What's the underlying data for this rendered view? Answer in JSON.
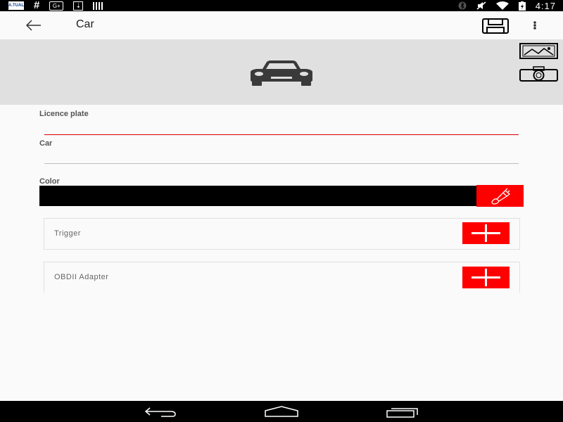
{
  "status_bar": {
    "left_icons": [
      "carrier-logo-icon",
      "hash-icon",
      "google-plus-icon",
      "download-icon",
      "barcode-icon"
    ],
    "carrier_text": "A.TUAL",
    "right_icons": [
      "bluetooth-icon",
      "mute-icon",
      "wifi-icon",
      "battery-icon"
    ],
    "time": "4:17"
  },
  "app_bar": {
    "title": "Car",
    "back_icon": "arrow-back-icon",
    "save_icon": "floppy-disk-icon",
    "overflow_icon": "more-vert-icon"
  },
  "header": {
    "image_icon": "car-icon",
    "gallery_icon": "image-icon",
    "camera_icon": "camera-icon"
  },
  "form": {
    "licence_plate": {
      "label": "Licence plate",
      "value": ""
    },
    "car": {
      "label": "Car",
      "value": ""
    },
    "color": {
      "label": "Color",
      "value": "#000000",
      "picker_icon": "paintbrush-icon"
    }
  },
  "sections": [
    {
      "label": "Trigger",
      "add_icon": "plus-icon"
    },
    {
      "label": "OBDII Adapter",
      "add_icon": "plus-icon"
    }
  ],
  "nav_bar": {
    "back_icon": "nav-back-icon",
    "home_icon": "nav-home-icon",
    "recents_icon": "nav-recents-icon"
  },
  "colors": {
    "accent": "#ff0000",
    "header_bg": "#e0e0e0",
    "error_underline": "#d50000",
    "color_swatch": "#000000"
  }
}
